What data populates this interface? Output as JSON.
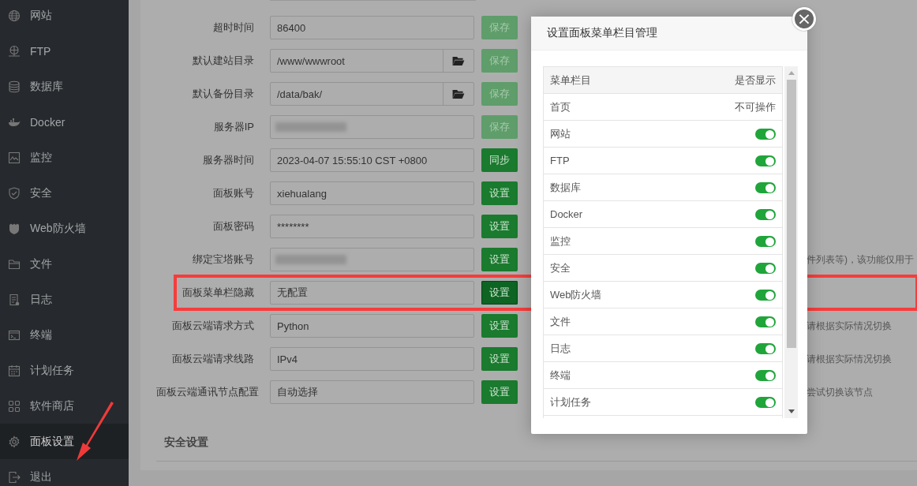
{
  "sidebar": {
    "items": [
      {
        "label": "网站",
        "selected": false
      },
      {
        "label": "FTP",
        "selected": false
      },
      {
        "label": "数据库",
        "selected": false
      },
      {
        "label": "Docker",
        "selected": false
      },
      {
        "label": "监控",
        "selected": false
      },
      {
        "label": "安全",
        "selected": false
      },
      {
        "label": "Web防火墙",
        "selected": false
      },
      {
        "label": "文件",
        "selected": false
      },
      {
        "label": "日志",
        "selected": false
      },
      {
        "label": "终端",
        "selected": false
      },
      {
        "label": "计划任务",
        "selected": false
      },
      {
        "label": "软件商店",
        "selected": false
      },
      {
        "label": "面板设置",
        "selected": true
      },
      {
        "label": "退出",
        "selected": false
      }
    ]
  },
  "settings": {
    "rows": [
      {
        "label": "超时时间",
        "value": "86400",
        "kind": "text",
        "button": "保存",
        "disabled": true,
        "highlighted": false
      },
      {
        "label": "默认建站目录",
        "value": "/www/wwwroot",
        "kind": "path",
        "button": "保存",
        "disabled": true,
        "highlighted": false
      },
      {
        "label": "默认备份目录",
        "value": "/data/bak/",
        "kind": "path",
        "button": "保存",
        "disabled": true,
        "highlighted": false
      },
      {
        "label": "服务器IP",
        "kind": "redacted",
        "button": "保存",
        "disabled": true,
        "highlighted": false
      },
      {
        "label": "服务器时间",
        "value": "2023-04-07 15:55:10 CST +0800",
        "kind": "text",
        "button": "同步",
        "disabled": false,
        "highlighted": false
      },
      {
        "label": "面板账号",
        "value": "xiehualang",
        "kind": "text",
        "button": "设置",
        "disabled": false,
        "highlighted": false
      },
      {
        "label": "面板密码",
        "value": "********",
        "kind": "text",
        "button": "设置",
        "disabled": false,
        "highlighted": false
      },
      {
        "label": "绑定宝塔账号",
        "kind": "redacted",
        "button": "设置",
        "disabled": false,
        "highlighted": false,
        "description": "件列表等)，该功能仅用于"
      },
      {
        "label": "面板菜单栏隐藏",
        "value": "无配置",
        "kind": "text",
        "button": "设置",
        "disabled": false,
        "highlighted": true
      },
      {
        "label": "面板云端请求方式",
        "value": "Python",
        "kind": "text",
        "button": "设置",
        "disabled": false,
        "highlighted": false,
        "description": "请根据实际情况切换"
      },
      {
        "label": "面板云端请求线路",
        "value": "IPv4",
        "kind": "text",
        "button": "设置",
        "disabled": false,
        "highlighted": false,
        "description": "请根据实际情况切换"
      },
      {
        "label": "面板云端通讯节点配置",
        "value": "自动选择",
        "kind": "text",
        "button": "设置",
        "disabled": false,
        "highlighted": false,
        "description": "尝试切换该节点"
      }
    ],
    "section_title": "安全设置"
  },
  "dialog": {
    "title": "设置面板菜单栏目管理",
    "close": "×",
    "columns": [
      "菜单栏目",
      "是否显示"
    ],
    "rows": [
      {
        "name": "首页",
        "kind": "fixed",
        "status": "不可操作"
      },
      {
        "name": "网站",
        "kind": "toggle",
        "on": true
      },
      {
        "name": "FTP",
        "kind": "toggle",
        "on": true
      },
      {
        "name": "数据库",
        "kind": "toggle",
        "on": true
      },
      {
        "name": "Docker",
        "kind": "toggle",
        "on": true
      },
      {
        "name": "监控",
        "kind": "toggle",
        "on": true
      },
      {
        "name": "安全",
        "kind": "toggle",
        "on": true
      },
      {
        "name": "Web防火墙",
        "kind": "toggle",
        "on": true
      },
      {
        "name": "文件",
        "kind": "toggle",
        "on": true
      },
      {
        "name": "日志",
        "kind": "toggle",
        "on": true
      },
      {
        "name": "终端",
        "kind": "toggle",
        "on": true
      },
      {
        "name": "计划任务",
        "kind": "toggle",
        "on": true
      }
    ]
  }
}
